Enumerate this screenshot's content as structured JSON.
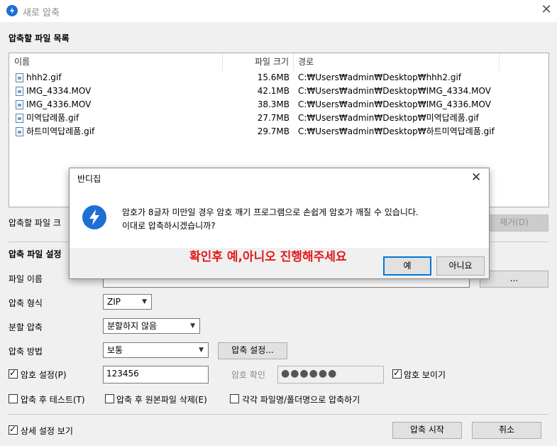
{
  "window": {
    "title": "새로 압축",
    "close": "✕"
  },
  "filelist": {
    "section_label": "압축할 파일 목록",
    "columns": [
      "이름",
      "파일 크기",
      "경로"
    ],
    "rows": [
      {
        "name": "hhh2.gif",
        "size": "15.6MB",
        "path": "C:₩Users₩admin₩Desktop₩hhh2.gif",
        "icon": "gif-file-icon"
      },
      {
        "name": "IMG_4334.MOV",
        "size": "42.1MB",
        "path": "C:₩Users₩admin₩Desktop₩IMG_4334.MOV",
        "icon": "video-file-icon"
      },
      {
        "name": "IMG_4336.MOV",
        "size": "38.3MB",
        "path": "C:₩Users₩admin₩Desktop₩IMG_4336.MOV",
        "icon": "video-file-icon"
      },
      {
        "name": "미역답례품.gif",
        "size": "27.7MB",
        "path": "C:₩Users₩admin₩Desktop₩미역답례품.gif",
        "icon": "gif-file-icon"
      },
      {
        "name": "하트미역답례품.gif",
        "size": "29.7MB",
        "path": "C:₩Users₩admin₩Desktop₩하트미역답례품.gif",
        "icon": "gif-file-icon"
      }
    ]
  },
  "summary": {
    "label_partial": "압축할 파일 크",
    "remove_button": "제거(D)"
  },
  "settings": {
    "section_label": "압축 파일 설정",
    "filename_label": "파일 이름",
    "filename_button": "...",
    "format_label": "압축 형식",
    "format_value": "ZIP",
    "split_label": "분할 압축",
    "split_value": "분할하지 않음",
    "method_label": "압축 방법",
    "method_value": "보통",
    "method_settings_button": "압축 설정...",
    "password_checkbox_label": "암호 설정(P)",
    "password_value": "123456",
    "password_confirm_label": "암호 확인",
    "password_confirm_value": "●●●●●●",
    "show_password_label": "암호 보이기",
    "test_after_label": "압축 후 테스트(T)",
    "delete_original_label": "압축 후 원본파일 삭제(E)",
    "each_file_label": "각각 파일명/폴더명으로 압축하기"
  },
  "footer": {
    "detail_label": "상세 설정 보기",
    "start_button": "압축 시작",
    "cancel_button": "취소"
  },
  "dialog": {
    "title": "반디집",
    "close": "✕",
    "message_line1": "암호가 8글자 미만일 경우 암호 깨기 프로그램으로 손쉽게 암호가 깨질 수 있습니다.",
    "message_line2": "이대로 압축하시겠습니까?",
    "yes_button": "예",
    "no_button": "아니요",
    "annotation": "확인후 예,아니오 진행해주세요"
  },
  "colors": {
    "accent": "#0078d7",
    "app_icon": "#1e6fd4",
    "annotation": "#e21b1b"
  }
}
